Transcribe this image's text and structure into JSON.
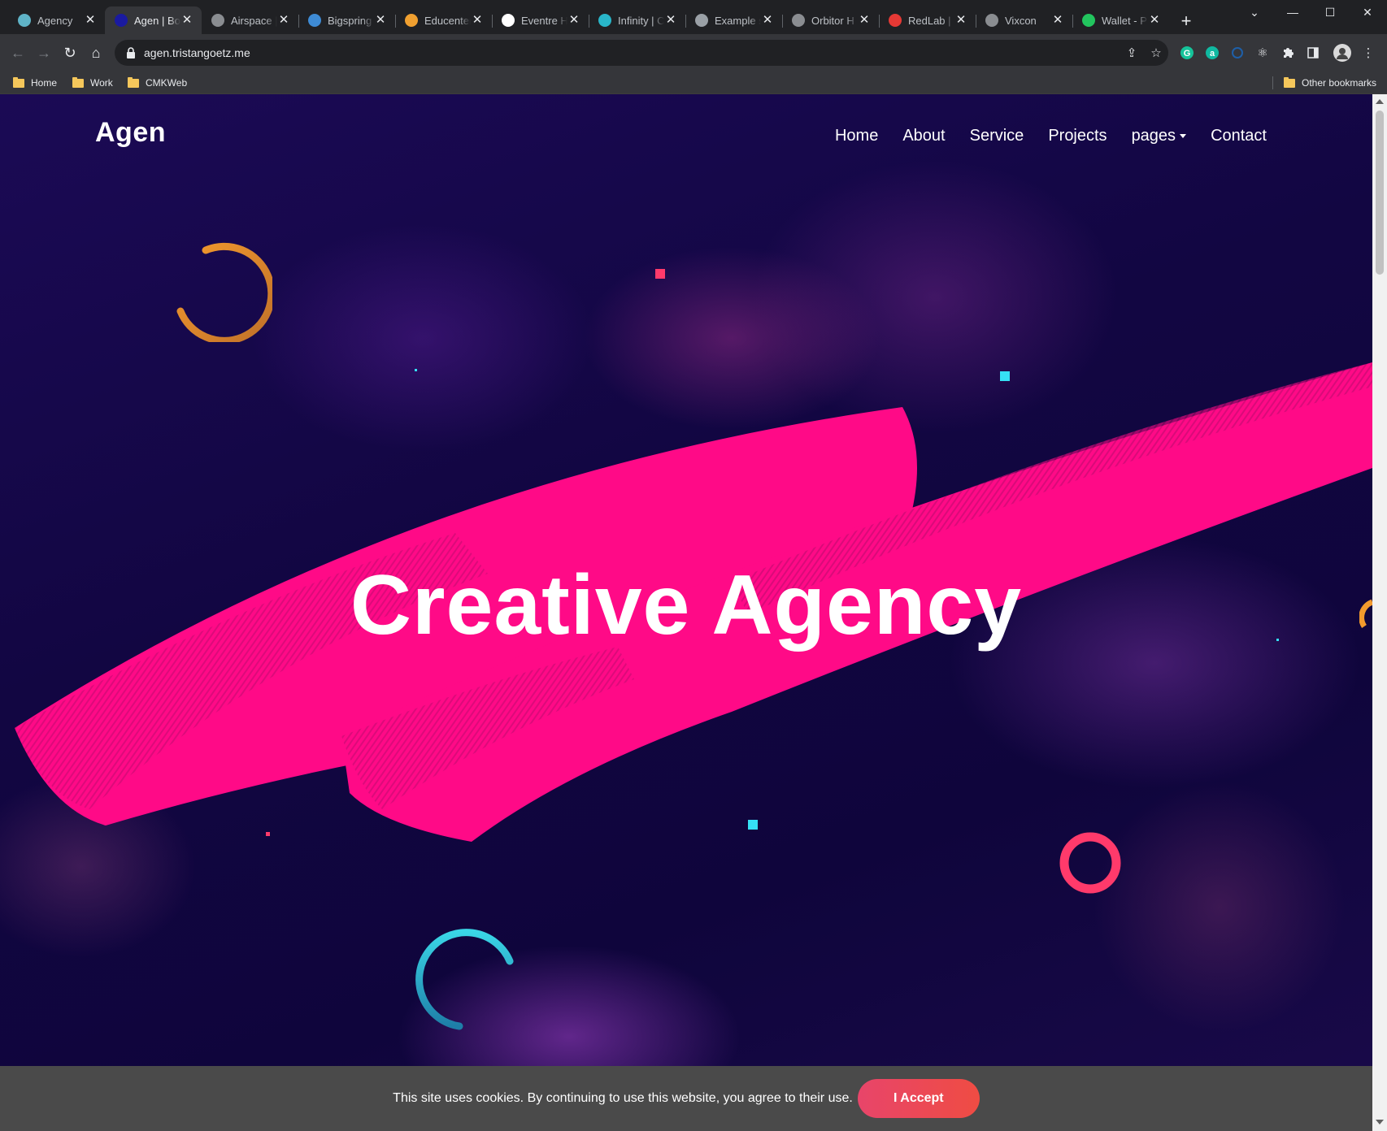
{
  "browser": {
    "tabs": [
      {
        "title": "Agency",
        "icon": "globe-teal-icon",
        "color": "#5fb3c7",
        "active": false
      },
      {
        "title": "Agen | Bo",
        "icon": "map-pin-icon",
        "color": "#1a1aa0",
        "active": true
      },
      {
        "title": "Airspace |",
        "icon": "globe-icon",
        "color": "#8a8d91",
        "active": false
      },
      {
        "title": "Bigspring",
        "icon": "bigspring-icon",
        "color": "#3e8bd5",
        "active": false
      },
      {
        "title": "Educenter",
        "icon": "educenter-icon",
        "color": "#f0a030",
        "active": false
      },
      {
        "title": "Eventre H",
        "icon": "eventre-icon",
        "color": "#ffffff",
        "active": false
      },
      {
        "title": "Infinity | C",
        "icon": "infinity-icon",
        "color": "#29b6c9",
        "active": false
      },
      {
        "title": "Example s",
        "icon": "wave-icon",
        "color": "#9aa0a6",
        "active": false
      },
      {
        "title": "Orbitor H",
        "icon": "globe-icon",
        "color": "#8a8d91",
        "active": false
      },
      {
        "title": "RedLab | F",
        "icon": "redlab-icon",
        "color": "#e53935",
        "active": false
      },
      {
        "title": "Vixcon",
        "icon": "globe-icon",
        "color": "#8a8d91",
        "active": false
      },
      {
        "title": "Wallet - P",
        "icon": "wallet-icon",
        "color": "#22c55e",
        "active": false
      }
    ],
    "url": "agen.tristangoetz.me",
    "bookmarks": [
      "Home",
      "Work",
      "CMKWeb"
    ],
    "other_bookmarks": "Other bookmarks",
    "extension_letter_a": "a"
  },
  "site": {
    "logo": "Agen",
    "nav": [
      {
        "label": "Home"
      },
      {
        "label": "About"
      },
      {
        "label": "Service"
      },
      {
        "label": "Projects"
      },
      {
        "label": "pages",
        "dropdown": true
      },
      {
        "label": "Contact"
      }
    ],
    "hero_title": "Creative Agency",
    "brush_color": "#ff0a87",
    "accent_colors": {
      "orange": "#f39a2d",
      "pink": "#ff3a6b",
      "cyan": "#26c6da"
    }
  },
  "cookie": {
    "message": "This site uses cookies. By continuing to use this website, you agree to their use.",
    "accept_label": "I Accept"
  }
}
